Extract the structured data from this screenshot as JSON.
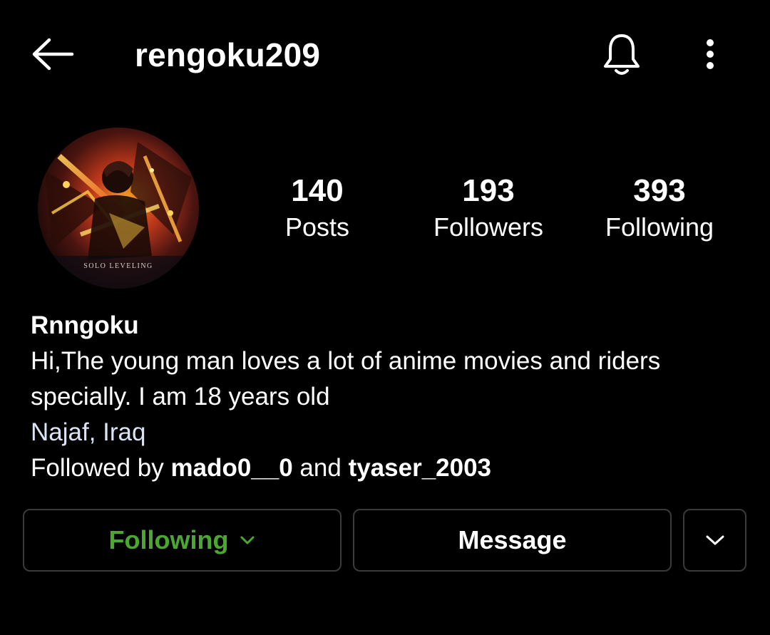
{
  "header": {
    "username": "rengoku209"
  },
  "profile": {
    "avatar_caption": "SOLO LEVELING",
    "stats": [
      {
        "value": "140",
        "label": "Posts"
      },
      {
        "value": "193",
        "label": "Followers"
      },
      {
        "value": "393",
        "label": "Following"
      }
    ],
    "display_name": "Rnngoku",
    "bio": "Hi,The young man loves a lot of anime movies and riders specially. I am 18 years old",
    "location": "Najaf, Iraq",
    "followed_by_prefix": "Followed by ",
    "followed_by_users": [
      "mado0__0",
      "tyaser_2003"
    ],
    "followed_by_conjunction": " and "
  },
  "actions": {
    "following_label": "Following",
    "message_label": "Message"
  },
  "colors": {
    "background": "#000000",
    "following_green": "#4aa82e",
    "location_link": "#dbe4f5",
    "button_border": "#3a3a3a"
  },
  "icons": {
    "back": "arrow-left-icon",
    "notifications": "bell-icon",
    "more": "more-vertical-icon",
    "following_dropdown": "chevron-down-icon",
    "suggestions": "chevron-down-icon"
  }
}
